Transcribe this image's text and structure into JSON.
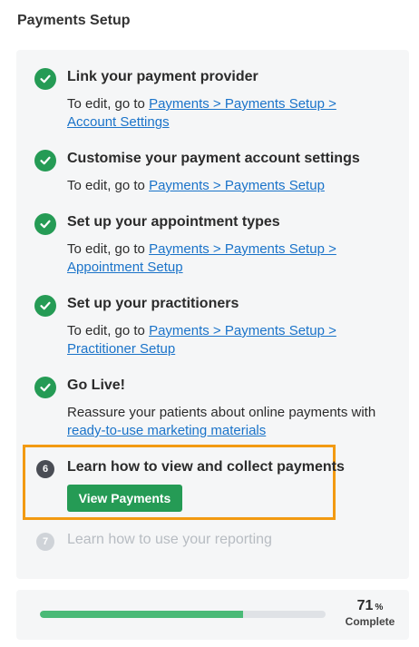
{
  "header": {
    "title": "Payments Setup"
  },
  "steps": [
    {
      "title": "Link your payment provider",
      "desc_prefix": "To edit, go to ",
      "link_line1": "Payments > Payments Setup >",
      "link_line2": "Account Settings"
    },
    {
      "title": "Customise your payment account settings",
      "desc_prefix": "To edit, go to ",
      "link_line1": "Payments > Payments Setup"
    },
    {
      "title": "Set up your appointment types",
      "desc_prefix": "To edit, go to ",
      "link_line1": "Payments > Payments Setup >",
      "link_line2": "Appointment Setup"
    },
    {
      "title": "Set up your practitioners",
      "desc_prefix": "To edit, go to ",
      "link_line1": "Payments > Payments Setup >",
      "link_line2": "Practitioner Setup"
    },
    {
      "title": "Go Live!",
      "desc_line1": "Reassure your patients about online payments with",
      "link_line2": "ready-to-use marketing materials"
    },
    {
      "number": "6",
      "title": "Learn how to view and collect payments",
      "button_label": "View Payments"
    },
    {
      "number": "7",
      "title": "Learn how to use your reporting"
    }
  ],
  "progress": {
    "value": "71",
    "percent_symbol": "%",
    "label": "Complete",
    "fraction": 0.71
  },
  "colors": {
    "success": "#259b55",
    "highlight": "#f29a12",
    "link": "#1a73c9",
    "progress_fill": "#4aba77"
  }
}
